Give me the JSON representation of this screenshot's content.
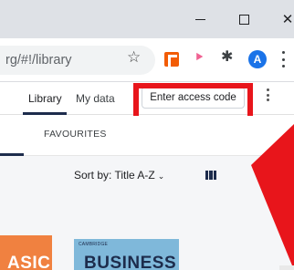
{
  "browser": {
    "window_controls": {
      "minimize_glyph": "",
      "maximize_glyph": "",
      "close_glyph": "✕"
    },
    "address_bar": {
      "url": "rg/#!/library",
      "star_icon": "star-icon"
    },
    "extensions": [
      {
        "icon": "orange-extension-icon",
        "color": "#f25c05"
      },
      {
        "icon": "pink-extension-icon",
        "color": "#f06292",
        "glyph": "⯈"
      },
      {
        "icon": "puzzle-icon",
        "glyph": "✚"
      }
    ],
    "profile": {
      "initial": "A",
      "color": "#1a73e8"
    }
  },
  "app": {
    "nav": {
      "library": "Library",
      "my_data": "My data"
    },
    "access_code_button": "Enter access code",
    "tabs": {
      "favourites": "FAVOURITES"
    },
    "sort": {
      "label": "Sort by: Title A-Z",
      "chevron": "⌄"
    },
    "books": [
      {
        "cover_text": "ASIC",
        "color": "#f08140"
      },
      {
        "publisher": "CAMBRIDGE",
        "cover_text": "BUSINESS",
        "color": "#7fb8da"
      }
    ]
  },
  "annotations": {
    "highlight_color": "#e8151b",
    "arrow_color": "#e8151b"
  }
}
